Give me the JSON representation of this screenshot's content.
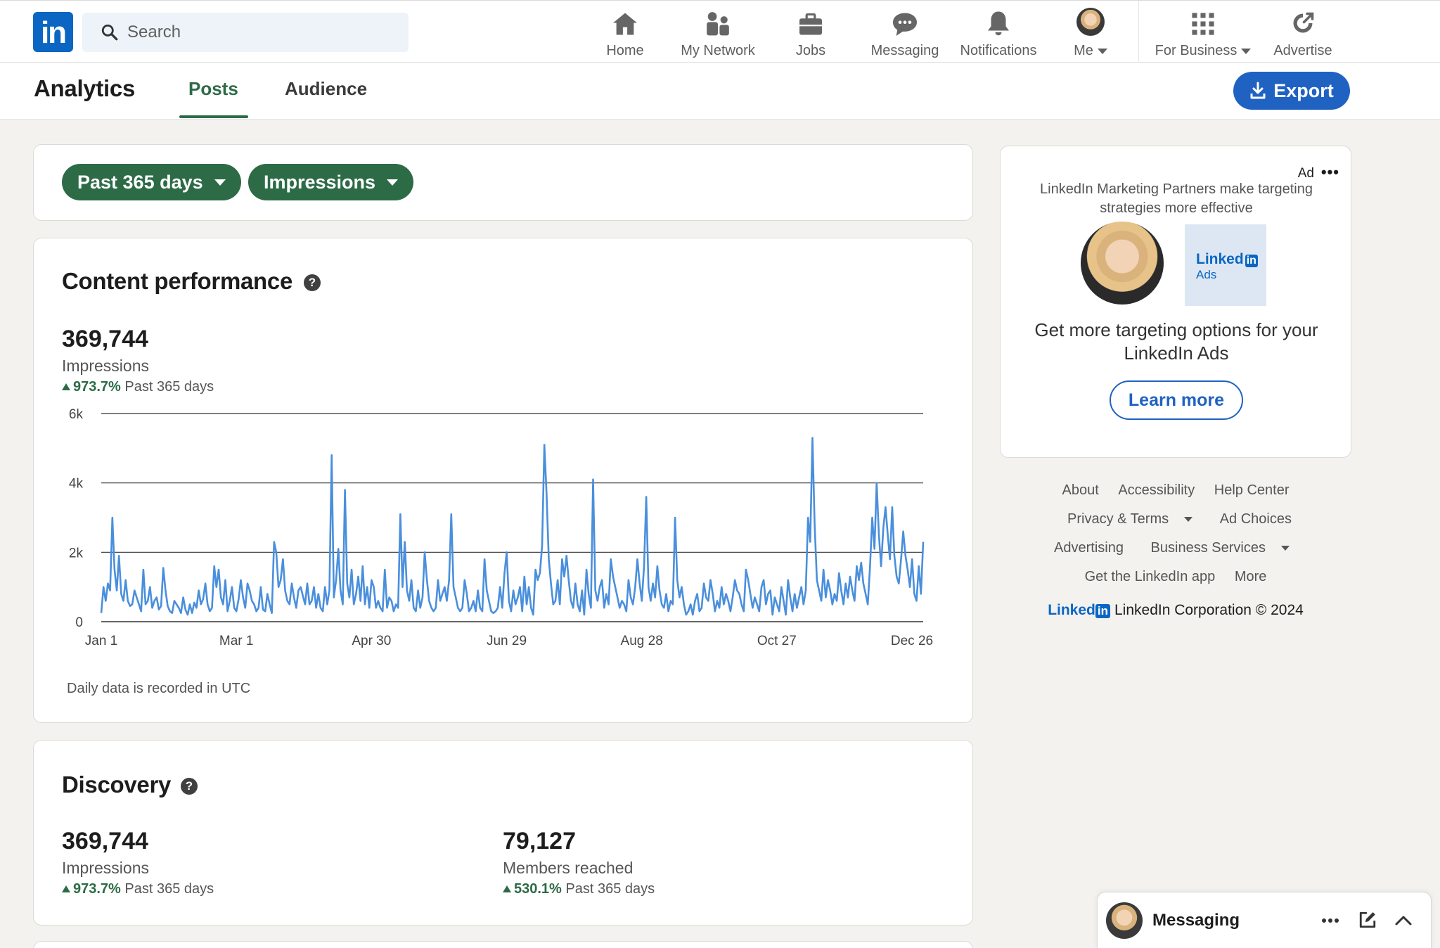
{
  "nav": {
    "search_placeholder": "Search",
    "items": [
      {
        "label": "Home",
        "icon": "home-icon"
      },
      {
        "label": "My Network",
        "icon": "network-icon"
      },
      {
        "label": "Jobs",
        "icon": "briefcase-icon"
      },
      {
        "label": "Messaging",
        "icon": "chat-icon"
      },
      {
        "label": "Notifications",
        "icon": "bell-icon"
      },
      {
        "label": "Me",
        "icon": "avatar"
      },
      {
        "label": "For Business",
        "icon": "grid-icon"
      },
      {
        "label": "Advertise",
        "icon": "compass-icon"
      }
    ],
    "logo": "in"
  },
  "subnav": {
    "title": "Analytics",
    "tabs": [
      {
        "label": "Posts",
        "active": true
      },
      {
        "label": "Audience",
        "active": false
      }
    ],
    "export_label": "Export"
  },
  "filters": {
    "range": "Past 365 days",
    "metric": "Impressions"
  },
  "content_performance": {
    "title": "Content performance",
    "help": "?",
    "value": "369,744",
    "label": "Impressions",
    "delta": "973.7%",
    "period": "Past 365 days",
    "footnote": "Daily data is recorded in UTC"
  },
  "chart_data": {
    "type": "line",
    "y_ticks": [
      "0",
      "2k",
      "4k",
      "6k"
    ],
    "ylim": [
      0,
      6000
    ],
    "x_ticks": [
      "Jan 1",
      "Mar 1",
      "Apr 30",
      "Jun 29",
      "Aug 28",
      "Oct 27",
      "Dec 26"
    ],
    "x_range_days": [
      0,
      365
    ],
    "color": "#4a8fdc",
    "grid": "horizontal",
    "values": [
      250,
      1000,
      600,
      1100,
      900,
      3000,
      1500,
      900,
      1900,
      800,
      600,
      1200,
      600,
      450,
      500,
      900,
      700,
      500,
      300,
      1500,
      500,
      600,
      1000,
      400,
      600,
      700,
      350,
      450,
      1550,
      900,
      450,
      300,
      250,
      600,
      500,
      400,
      250,
      700,
      350,
      200,
      500,
      250,
      550,
      400,
      900,
      500,
      650,
      1100,
      500,
      300,
      400,
      1600,
      1000,
      1500,
      700,
      500,
      1200,
      300,
      600,
      1000,
      400,
      300,
      650,
      1200,
      700,
      400,
      1100,
      900,
      600,
      500,
      300,
      400,
      1000,
      350,
      300,
      800,
      500,
      250,
      2300,
      2000,
      1000,
      1200,
      1800,
      900,
      600,
      500,
      1100,
      700,
      400,
      900,
      1000,
      750,
      500,
      1100,
      500,
      600,
      1000,
      400,
      800,
      400,
      300,
      1000,
      500,
      900,
      4800,
      700,
      1200,
      2100,
      900,
      500,
      3800,
      1100,
      700,
      1500,
      500,
      800,
      1300,
      600,
      1600,
      500,
      1000,
      400,
      1200,
      1000,
      400,
      600,
      400,
      300,
      1500,
      400,
      700,
      600,
      300,
      500,
      400,
      3100,
      1000,
      2300,
      900,
      600,
      1200,
      400,
      300,
      900,
      400,
      700,
      2000,
      1200,
      600,
      400,
      300,
      400,
      1200,
      600,
      800,
      1000,
      600,
      1200,
      3100,
      1000,
      700,
      400,
      300,
      400,
      1200,
      800,
      300,
      400,
      600,
      300,
      900,
      400,
      300,
      1800,
      900,
      600,
      300,
      250,
      300,
      400,
      1000,
      400,
      1400,
      2000,
      600,
      300,
      900,
      500,
      700,
      1000,
      300,
      1300,
      500,
      1000,
      400,
      200,
      1500,
      1200,
      1400,
      2200,
      5100,
      3700,
      1800,
      1100,
      500,
      600,
      1200,
      500,
      1800,
      1300,
      1900,
      1200,
      600,
      400,
      1100,
      500,
      300,
      900,
      200,
      1500,
      800,
      400,
      4100,
      900,
      600,
      1000,
      1200,
      400,
      800,
      500,
      1800,
      1300,
      1000,
      700,
      400,
      600,
      500,
      300,
      1200,
      700,
      500,
      1000,
      1800,
      1100,
      600,
      1600,
      3600,
      1000,
      600,
      1100,
      700,
      1600,
      900,
      500,
      400,
      800,
      300,
      600,
      500,
      3000,
      1200,
      700,
      1000,
      500,
      200,
      300,
      500,
      200,
      600,
      800,
      300,
      400,
      1100,
      700,
      600,
      1200,
      800,
      300,
      600,
      400,
      1000,
      500,
      800,
      600,
      300,
      700,
      1200,
      900,
      800,
      500,
      300,
      1500,
      1200,
      800,
      400,
      700,
      500,
      300,
      1000,
      1200,
      500,
      800,
      900,
      200,
      700,
      500,
      300,
      1000,
      600,
      200,
      1200,
      700,
      300,
      800,
      400,
      700,
      1000,
      500,
      900,
      3000,
      2300,
      5300,
      2800,
      1200,
      900,
      600,
      1500,
      700,
      1200,
      900,
      500,
      800,
      600,
      1400,
      900,
      500,
      1100,
      700,
      1300,
      900,
      600,
      1600,
      1200,
      1700,
      1100,
      800,
      500,
      1600,
      3000,
      2100,
      4000,
      2500,
      1600,
      2700,
      3300,
      2500,
      1800,
      3300,
      1900,
      1300,
      1100,
      1800,
      2600,
      1900,
      1500,
      1000,
      1800,
      800,
      600,
      1600,
      800,
      2300
    ]
  },
  "discovery": {
    "title": "Discovery",
    "help": "?",
    "metrics": [
      {
        "value": "369,744",
        "label": "Impressions",
        "delta": "973.7%",
        "period": "Past 365 days"
      },
      {
        "value": "79,127",
        "label": "Members reached",
        "delta": "530.1%",
        "period": "Past 365 days"
      }
    ]
  },
  "ad": {
    "label": "Ad",
    "more": "•••",
    "subtitle": "LinkedIn Marketing Partners make targeting strategies more effective",
    "logo_text": "Linked",
    "logo_in": "in",
    "logo_sub": "Ads",
    "headline": "Get more targeting options for your LinkedIn Ads",
    "cta": "Learn more"
  },
  "footer": {
    "links": [
      "About",
      "Accessibility",
      "Help Center",
      "Privacy & Terms",
      "Ad Choices",
      "Advertising",
      "Business Services",
      "Get the LinkedIn app",
      "More"
    ],
    "brand": "Linked",
    "brand_in": "in",
    "copyright": "LinkedIn Corporation © 2024"
  },
  "messaging_bar": {
    "title": "Messaging"
  }
}
